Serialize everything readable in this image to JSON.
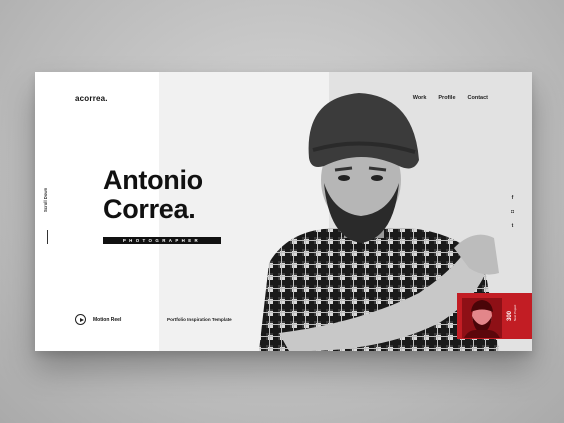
{
  "brand": {
    "logo": "acorrea."
  },
  "nav": {
    "items": [
      "Work",
      "Profile",
      "Contact"
    ]
  },
  "side": {
    "scroll_label": "Scroll Down"
  },
  "hero": {
    "name_line1": "Antonio",
    "name_line2": "Correa.",
    "role": "PHOTOGRAPHER"
  },
  "footer": {
    "motion_reel": "Motion Reel",
    "template_caption": "Portfolio Inspiration Template"
  },
  "social": {
    "icons": [
      "facebook-icon",
      "instagram-icon",
      "twitter-icon"
    ],
    "glyphs": [
      "f",
      "◘",
      "t"
    ]
  },
  "thumbnail": {
    "number": "300",
    "subtitle": "Next Project"
  },
  "colors": {
    "accent": "#c21d24",
    "text": "#111111"
  }
}
